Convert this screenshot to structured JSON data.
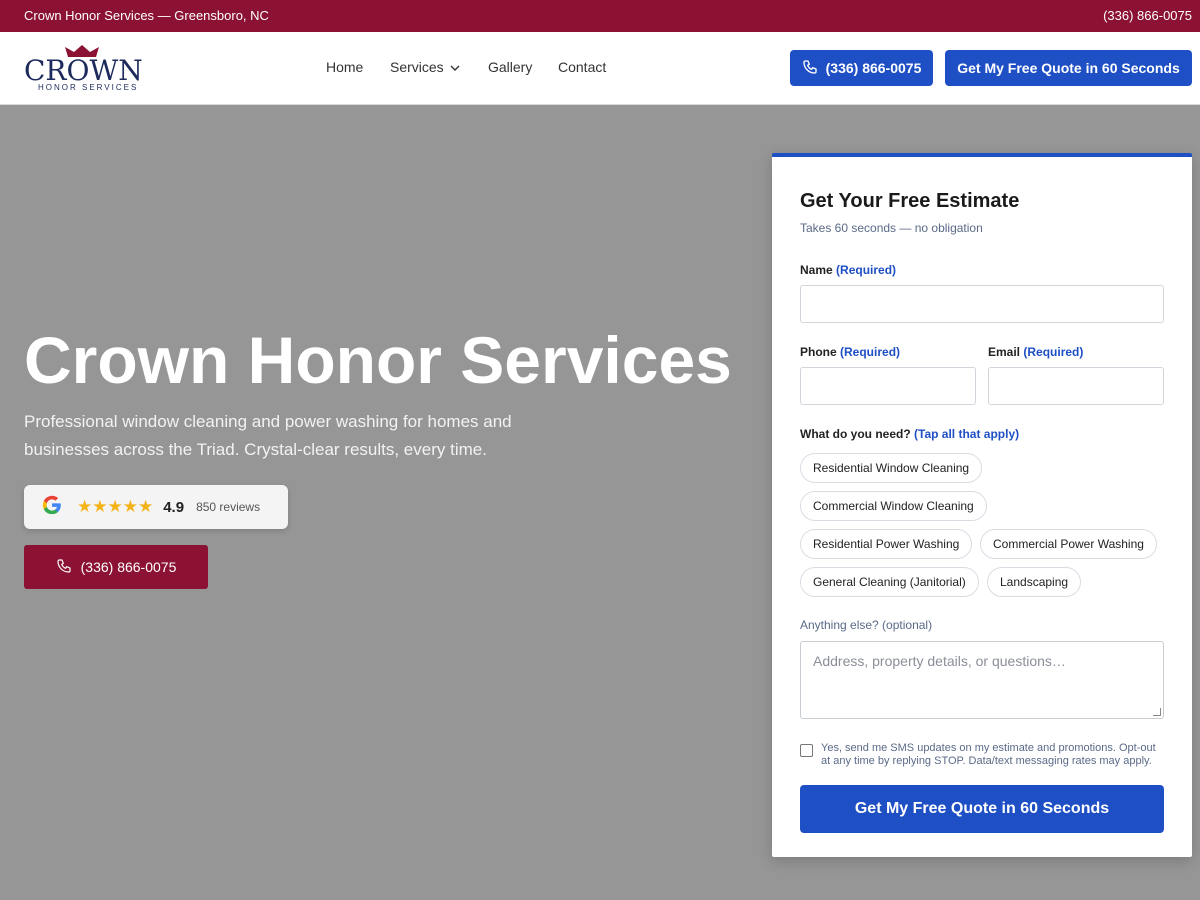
{
  "topbar": {
    "location": "Crown Honor Services — Greensboro, NC",
    "phone": "(336) 866-0075"
  },
  "logo": {
    "word": "CROWN",
    "sub": "HONOR SERVICES"
  },
  "nav": {
    "items": [
      {
        "label": "Home"
      },
      {
        "label": "Services",
        "has_dropdown": true
      },
      {
        "label": "Gallery"
      },
      {
        "label": "Contact"
      }
    ]
  },
  "header": {
    "phone_label": "(336) 866-0075",
    "quote_label": "Get My Free Quote in 60 Seconds"
  },
  "hero": {
    "title": "Crown Honor Services",
    "subtitle": "Professional window cleaning and power washing for homes and businesses across the Triad. Crystal-clear results, every time.",
    "review": {
      "rating": "4.9",
      "count": "850 reviews",
      "stars": 5
    },
    "phone_label": "(336) 866-0075"
  },
  "form": {
    "title": "Get Your Free Estimate",
    "tagline": "Takes 60 seconds — no obligation",
    "name_label": "Name",
    "phone_label": "Phone",
    "email_label": "Email",
    "required": "(Required)",
    "need_label": "What do you need?",
    "need_hint": "(Tap all that apply)",
    "services": [
      "Residential Window Cleaning",
      "Commercial Window Cleaning",
      "Residential Power Washing",
      "Commercial Power Washing",
      "General Cleaning (Janitorial)",
      "Landscaping"
    ],
    "optional_label": "Anything else? (optional)",
    "optional_placeholder": "Address, property details, or questions…",
    "sms_text": "Yes, send me SMS updates on my estimate and promotions. Opt-out at any time by replying STOP. Data/text messaging rates may apply.",
    "submit_label": "Get My Free Quote in 60 Seconds"
  },
  "colors": {
    "brand_maroon": "#8b1232",
    "accent_blue": "#1e4fc4",
    "star_gold": "#f3b41b"
  }
}
